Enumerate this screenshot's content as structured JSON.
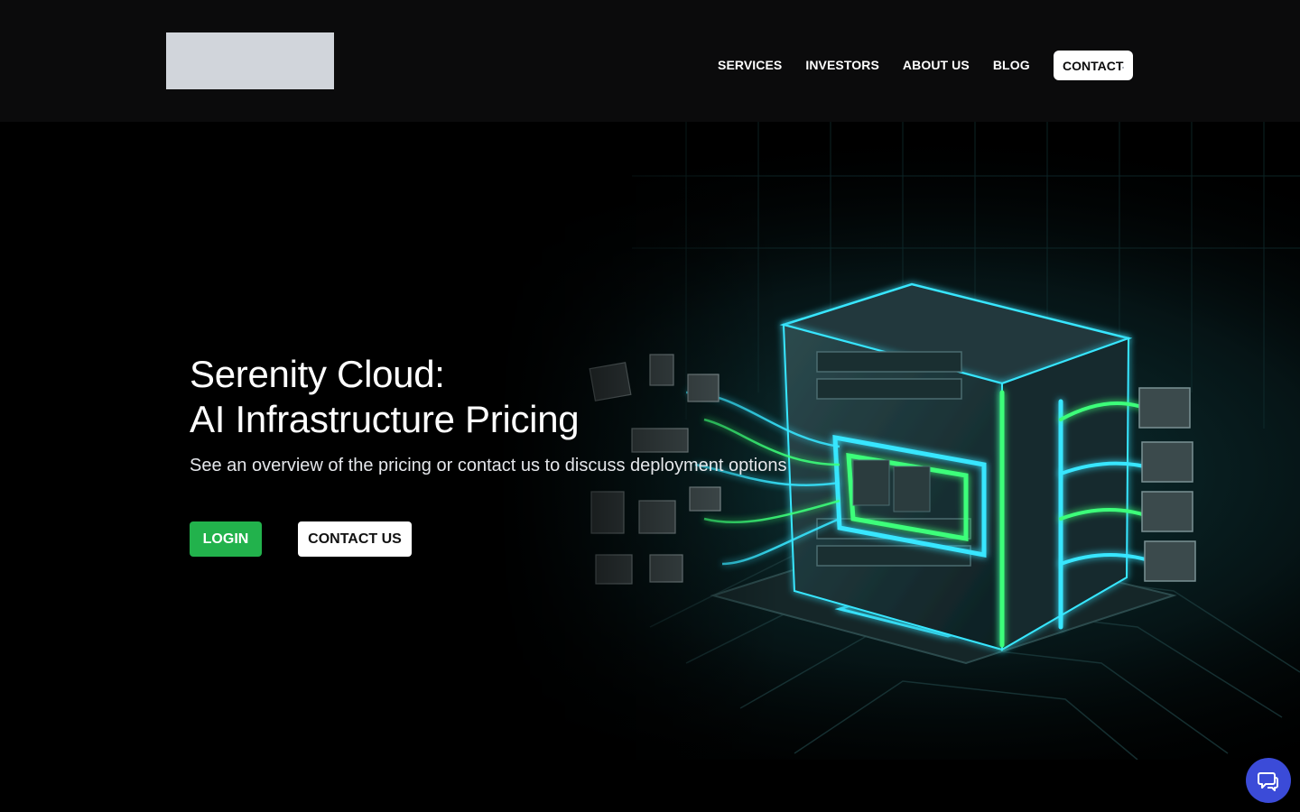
{
  "nav": {
    "items": [
      "SERVICES",
      "INVESTORS",
      "ABOUT US",
      "BLOG"
    ],
    "cta_label": "CONTACT"
  },
  "hero": {
    "title_line1": "Serenity Cloud:",
    "title_line2": "AI Infrastructure Pricing",
    "subtitle": "See an overview of the pricing or contact us to discuss deployment options",
    "login_label": "LOGIN",
    "contact_label": "CONTACT US"
  },
  "colors": {
    "header_bg": "#0b0b0c",
    "login_green": "#22b24c",
    "chat_blue": "#3b4bd8",
    "glow_cyan": "#37e6ff",
    "glow_green": "#3cff7a"
  },
  "icons": {
    "chat": "chat-bubble-icon"
  }
}
